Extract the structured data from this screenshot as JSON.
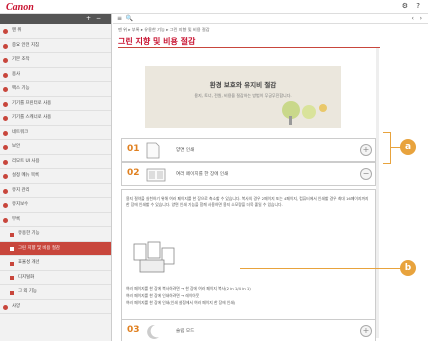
{
  "header": {
    "logo": "Canon",
    "icons": [
      "gear-icon",
      "help-icon"
    ]
  },
  "sidebar": {
    "items": [
      {
        "label": "맨 위",
        "type": "item"
      },
      {
        "label": "중요 안전 지침",
        "type": "item"
      },
      {
        "label": "기본 조작",
        "type": "item"
      },
      {
        "label": "용사",
        "type": "item"
      },
      {
        "label": "팩스 기능",
        "type": "item"
      },
      {
        "label": "기기를 프린터로 사용",
        "type": "item"
      },
      {
        "label": "기기를 스캐너로 사용",
        "type": "item"
      },
      {
        "label": "네트워크",
        "type": "item"
      },
      {
        "label": "보안",
        "type": "item"
      },
      {
        "label": "리모트 UI 사용",
        "type": "item"
      },
      {
        "label": "설정 메뉴 목록",
        "type": "item"
      },
      {
        "label": "유지 관리",
        "type": "item"
      },
      {
        "label": "유지보수",
        "type": "item"
      },
      {
        "label": "부록",
        "type": "item"
      },
      {
        "label": "유용한 기능",
        "type": "sub"
      },
      {
        "label": "그린 지향 및 비용 절감",
        "type": "active"
      },
      {
        "label": "효율성 개선",
        "type": "sub"
      },
      {
        "label": "디지털화",
        "type": "sub"
      },
      {
        "label": "그 외 기능",
        "type": "sub"
      },
      {
        "label": "사양",
        "type": "item"
      }
    ]
  },
  "main": {
    "breadcrumb": "맨 위 ▸ 부록 ▸ 유용한 기능 ▸ 그린 지향 및 비용 절감",
    "title": "그린 지향 및 비용 절감",
    "banner_title": "환경 보호와 유지비 절감",
    "banner_sub": "용지, 토너, 전원, 비용을 절감하는 방법이 무궁무진합니다.",
    "cards": [
      {
        "num": "01",
        "label": "양면 인쇄"
      },
      {
        "num": "02",
        "label": "여러 페이지를 한 장에 인쇄"
      },
      {
        "num": "03",
        "label": "슬립 모드"
      }
    ],
    "expand_para": "용지 절약을 실천하기 위해 여러 페이지를 한 장으로 축소할 수 있습니다. 복사의 경우 2페이지 또는 4페이지, 컴퓨터에서 인쇄할 경우 최대 16페이지까지 한 장에 인쇄할 수 있습니다. 양면 인쇄 기능을 함께 사용하면 용지 소모량을 더욱 줄일 수 있습니다.",
    "line1": "여러 페이지를 한 장에 복사하려면 → 한 장에 여러 페이지 복사(2 in 1/4 in 1)",
    "line2": "여러 페이지를 한 장에 인쇄하려면 → 레이아웃",
    "line3": "여러 페이지를 한 장에 인쇄(인쇄 설정에서 여러 페이지 한 장에 인쇄)"
  },
  "callouts": {
    "a": "a",
    "b": "b"
  }
}
